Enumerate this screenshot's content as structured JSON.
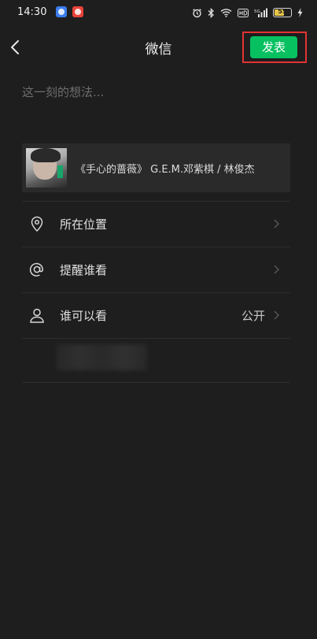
{
  "status_bar": {
    "time": "14:30",
    "battery_level": "55"
  },
  "header": {
    "title": "微信",
    "publish_label": "发表"
  },
  "composer": {
    "placeholder": "这一刻的想法..."
  },
  "music": {
    "song": "《手心的蔷薇》 G.E.M.邓紫棋 / 林俊杰"
  },
  "options": [
    {
      "label": "所在位置",
      "icon": "location-pin-icon",
      "value": ""
    },
    {
      "label": "提醒谁看",
      "icon": "at-sign-icon",
      "value": ""
    },
    {
      "label": "谁可以看",
      "icon": "person-icon",
      "value": "公开"
    }
  ],
  "colors": {
    "background": "#1e1e1e",
    "accent": "#07c160",
    "highlight_frame": "#e23333"
  }
}
